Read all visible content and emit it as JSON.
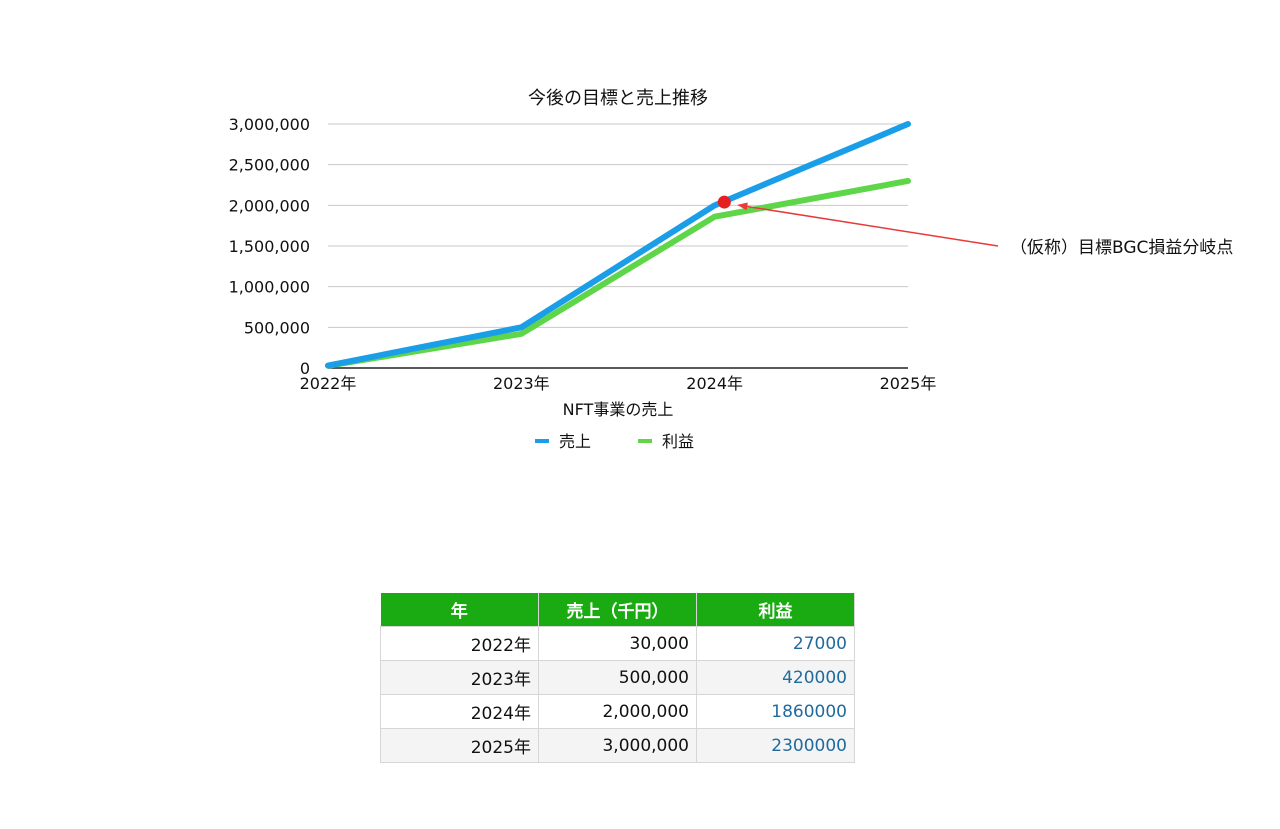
{
  "chart_data": {
    "type": "line",
    "title": "今後の目標と売上推移",
    "xlabel": "NFT事業の売上",
    "ylabel": "",
    "categories": [
      "2022年",
      "2023年",
      "2024年",
      "2025年"
    ],
    "ylim": [
      0,
      3000000
    ],
    "yticks": [
      {
        "value": 0,
        "label": "0"
      },
      {
        "value": 500000,
        "label": "500,000"
      },
      {
        "value": 1000000,
        "label": "1,000,000"
      },
      {
        "value": 1500000,
        "label": "1,500,000"
      },
      {
        "value": 2000000,
        "label": "2,000,000"
      },
      {
        "value": 2500000,
        "label": "2,500,000"
      },
      {
        "value": 3000000,
        "label": "3,000,000"
      }
    ],
    "grid": true,
    "legend_position": "bottom",
    "series": [
      {
        "name": "売上",
        "color": "#1a9ee8",
        "values": [
          30000,
          500000,
          2000000,
          3000000
        ]
      },
      {
        "name": "利益",
        "color": "#5fd64a",
        "values": [
          27000,
          420000,
          1860000,
          2300000
        ]
      }
    ],
    "annotation": {
      "text": "（仮称）目標BGC損益分岐点",
      "x_index": 2.05,
      "y": 2040000,
      "marker_color": "#e52020",
      "arrow_color": "#e83a3a"
    }
  },
  "table": {
    "headers": [
      "年",
      "売上（千円）",
      "利益"
    ],
    "header_color": "#1aaa12",
    "rows": [
      [
        "2022年",
        "30,000",
        "27000"
      ],
      [
        "2023年",
        "500,000",
        "420000"
      ],
      [
        "2024年",
        "2,000,000",
        "1860000"
      ],
      [
        "2025年",
        "3,000,000",
        "2300000"
      ]
    ]
  }
}
